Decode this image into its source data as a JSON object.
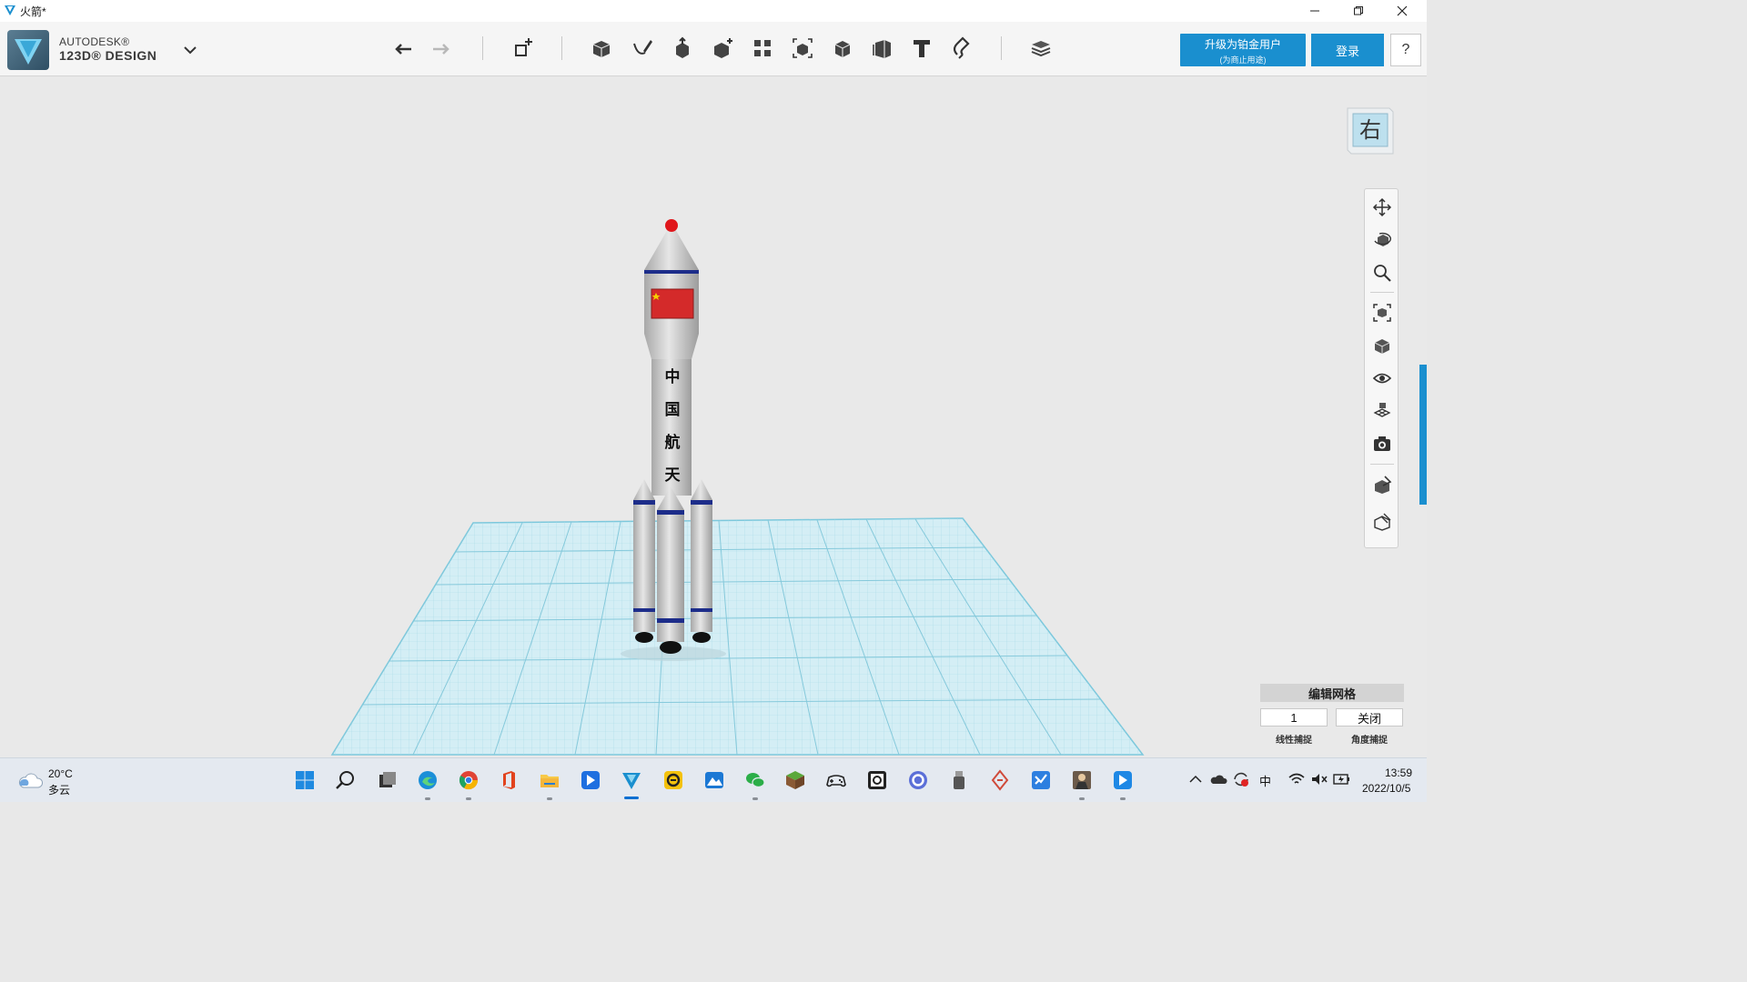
{
  "window": {
    "title": "火箭*"
  },
  "brand": {
    "line1": "AUTODESK®",
    "line2": "123D® DESIGN"
  },
  "toolbar": {
    "icons": [
      "undo-icon",
      "redo-icon",
      "transform-icon",
      "primitives-icon",
      "sketch-icon",
      "construct-icon",
      "modify-icon",
      "pattern-icon",
      "group-icon",
      "combine-icon",
      "measure-icon",
      "text-icon",
      "snap-icon",
      "material-icon"
    ],
    "upgrade_label": "升级为铂金用户",
    "upgrade_sub": "(为商止用途)",
    "login_label": "登录",
    "help_label": "?"
  },
  "viewcube": {
    "face_label": "右"
  },
  "navigation": {
    "icons": [
      "pan-icon",
      "orbit-icon",
      "zoom-icon",
      "fit-icon",
      "view-icon",
      "visibility-icon",
      "grid-icon",
      "camera-icon",
      "material-tool-icon",
      "outline-icon"
    ]
  },
  "rocket": {
    "text": [
      "中",
      "国",
      "航",
      "天"
    ]
  },
  "grid_panel": {
    "title": "编辑网格",
    "linear_snap_value": "1",
    "angle_snap_value": "关闭",
    "linear_snap_label": "线性捕捉",
    "angle_snap_label": "角度捕捉"
  },
  "taskbar": {
    "weather_temp": "20°C",
    "weather_desc": "多云",
    "tray_lang": "中",
    "time": "13:59",
    "date": "2022/10/5"
  },
  "colors": {
    "accent": "#1a8fcf",
    "grid": "#9fd8e6",
    "rocket_body": "#c8c8c8",
    "flag": "#d42a2a",
    "band": "#1d2d8a"
  }
}
